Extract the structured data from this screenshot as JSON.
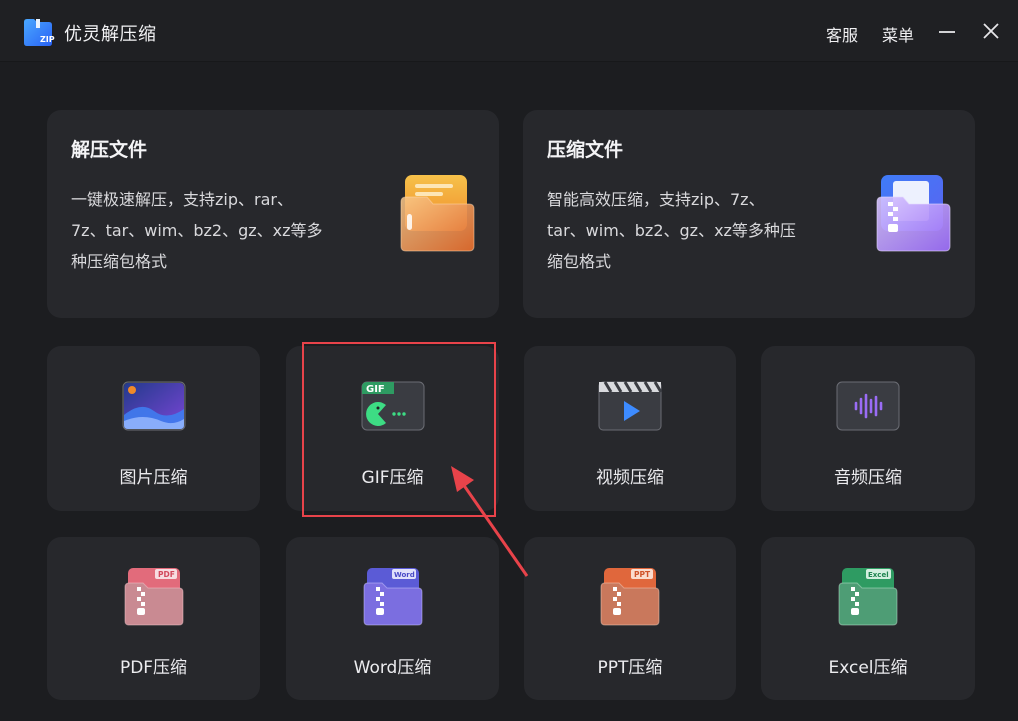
{
  "app": {
    "title": "优灵解压缩",
    "logo_icon": "zip-folder-icon",
    "logo_text": "ZIP"
  },
  "titlebar": {
    "service_label": "客服",
    "menu_label": "菜单"
  },
  "cards": {
    "extract": {
      "title": "解压文件",
      "desc_line1": "一键极速解压，支持zip、rar、",
      "desc_line2": "7z、tar、wim、bz2、gz、xz等多",
      "desc_line3": "种压缩包格式",
      "icon": "orange-folder-icon"
    },
    "compress": {
      "title": "压缩文件",
      "desc_line1": "智能高效压缩，支持zip、7z、",
      "desc_line2": "tar、wim、bz2、gz、xz等多种压",
      "desc_line3": "缩包格式",
      "icon": "purple-zip-folder-icon"
    },
    "image": {
      "label": "图片压缩",
      "icon": "image-icon"
    },
    "gif": {
      "label": "GIF压缩",
      "icon": "gif-icon",
      "badge": "GIF"
    },
    "video": {
      "label": "视频压缩",
      "icon": "video-icon"
    },
    "audio": {
      "label": "音频压缩",
      "icon": "audio-wave-icon"
    },
    "pdf": {
      "label": "PDF压缩",
      "icon": "pdf-zip-icon",
      "badge": "PDF"
    },
    "word": {
      "label": "Word压缩",
      "icon": "word-zip-icon",
      "badge": "Word"
    },
    "ppt": {
      "label": "PPT压缩",
      "icon": "ppt-zip-icon",
      "badge": "PPT"
    },
    "excel": {
      "label": "Excel压缩",
      "icon": "excel-zip-icon",
      "badge": "Excel"
    }
  },
  "colors": {
    "background": "#1c1d20",
    "card": "#27282c",
    "annotation": "#e8434a",
    "pdf": "#e26b7b",
    "word": "#5b5bd6",
    "ppt": "#e0673c",
    "excel": "#2e9b62"
  }
}
